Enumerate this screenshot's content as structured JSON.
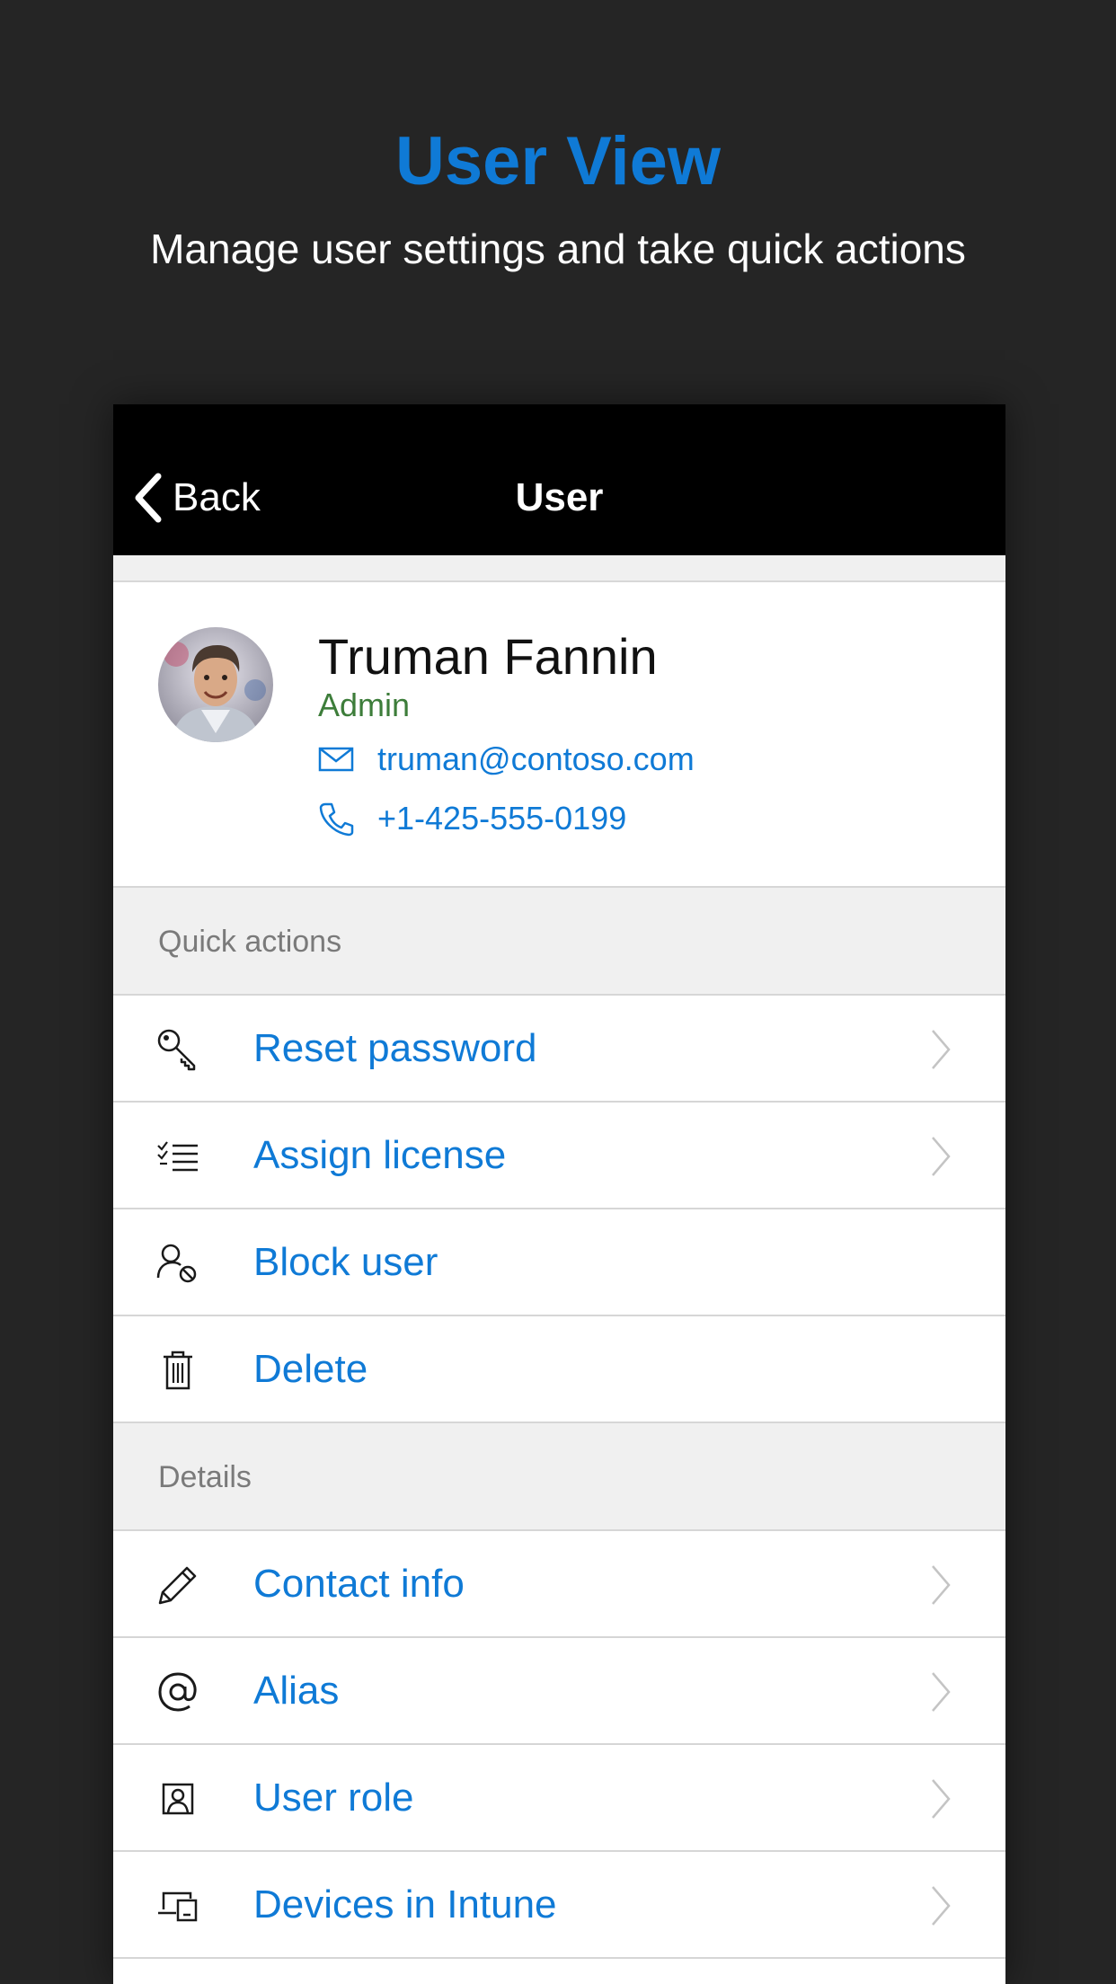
{
  "promo": {
    "title": "User View",
    "subtitle": "Manage user settings and take quick actions"
  },
  "navbar": {
    "back_label": "Back",
    "title": "User"
  },
  "profile": {
    "name": "Truman Fannin",
    "role": "Admin",
    "email": "truman@contoso.com",
    "phone": "+1-425-555-0199"
  },
  "quick_actions": {
    "header": "Quick actions",
    "items": [
      {
        "label": "Reset password",
        "icon": "key-icon",
        "chevron": true
      },
      {
        "label": "Assign license",
        "icon": "checklist-icon",
        "chevron": true
      },
      {
        "label": "Block user",
        "icon": "block-user-icon",
        "chevron": false
      },
      {
        "label": "Delete",
        "icon": "trash-icon",
        "chevron": false
      }
    ]
  },
  "details": {
    "header": "Details",
    "items": [
      {
        "label": "Contact info",
        "icon": "pencil-icon",
        "chevron": true
      },
      {
        "label": "Alias",
        "icon": "at-icon",
        "chevron": true
      },
      {
        "label": "User role",
        "icon": "user-role-icon",
        "chevron": true
      },
      {
        "label": "Devices in Intune",
        "icon": "devices-icon",
        "chevron": true
      }
    ]
  },
  "colors": {
    "accent": "#0f7ad6",
    "role_green": "#3d7d3a",
    "background": "#252525",
    "navbar": "#000000"
  }
}
